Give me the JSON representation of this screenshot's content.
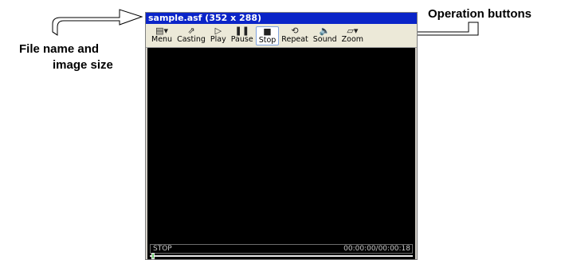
{
  "annotations": {
    "file_info_line1": "File name and",
    "file_info_line2": "image size",
    "operation_buttons": "Operation buttons"
  },
  "player": {
    "title": "sample.asf (352 x 288)",
    "toolbar": [
      {
        "label": "Menu",
        "icon": "menu-icon",
        "glyph": "▤▾"
      },
      {
        "label": "Casting",
        "icon": "casting-icon",
        "glyph": "⇗"
      },
      {
        "label": "Play",
        "icon": "play-icon",
        "glyph": "▷"
      },
      {
        "label": "Pause",
        "icon": "pause-icon",
        "glyph": "❚❚"
      },
      {
        "label": "Stop",
        "icon": "stop-icon",
        "glyph": "■",
        "active": true
      },
      {
        "label": "Repeat",
        "icon": "repeat-icon",
        "glyph": "⟲"
      },
      {
        "label": "Sound",
        "icon": "sound-icon",
        "glyph": "🔈"
      },
      {
        "label": "Zoom",
        "icon": "zoom-icon",
        "glyph": "▱▾"
      }
    ],
    "status": {
      "state": "STOP",
      "time": "00:00:00/00:00:18",
      "progress": 0
    }
  }
}
